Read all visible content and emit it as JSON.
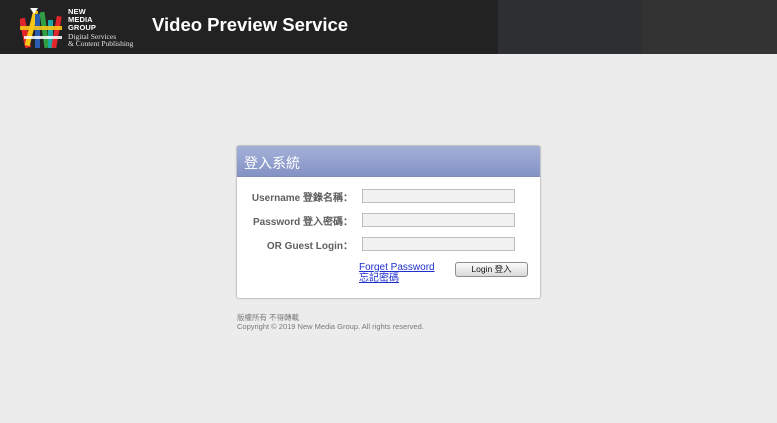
{
  "header": {
    "logo_line1": "NEW",
    "logo_line2": "MEDIA",
    "logo_line3": "GROUP",
    "logo_sub1": "Digital Services",
    "logo_sub2": "& Content Publishing",
    "title": "Video Preview Service",
    "colors": {
      "background": "#222222",
      "logo_red": "#e0262b",
      "logo_yellow": "#f7c718",
      "logo_blue": "#2a5db0",
      "logo_green": "#2f9e44",
      "logo_teal": "#1ea7a4"
    }
  },
  "login": {
    "title": "登入系統",
    "username_label": "Username 登錄名稱：",
    "username_value": "",
    "password_label": "Password 登入密碼：",
    "password_value": "",
    "guest_label": "OR Guest Login：",
    "guest_value": "",
    "forget_line1": "Forget Password",
    "forget_line2": "忘記密碼",
    "login_button": "Login 登入",
    "colors": {
      "header_gradient_top": "#a3b1d8",
      "header_gradient_bottom": "#8393c4",
      "link": "#1e2fcf"
    }
  },
  "footer": {
    "rights_zh": "版權所有 不得轉載",
    "copyright": "Copyright © 2019 New Media Group. All rights reserved."
  }
}
